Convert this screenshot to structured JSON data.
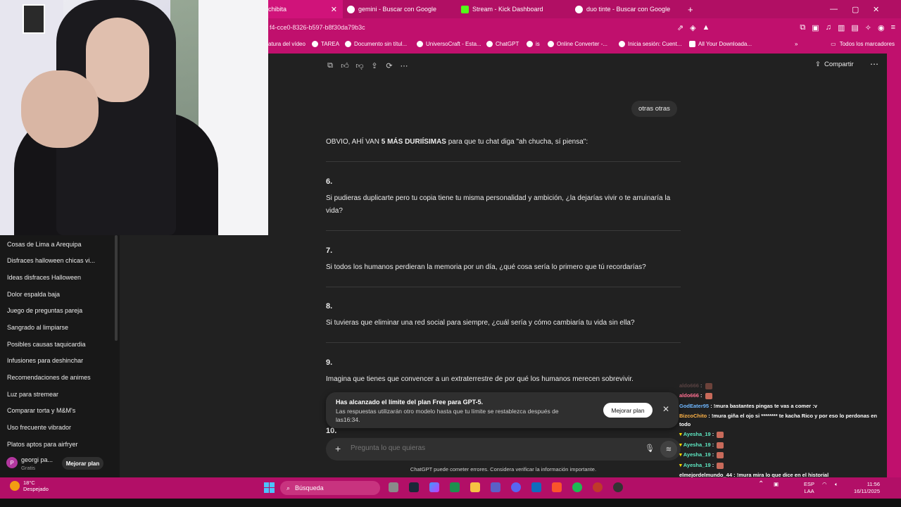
{
  "tabs": [
    {
      "label": "chibita",
      "active": true
    },
    {
      "label": "gemini - Buscar con Google"
    },
    {
      "label": "Stream - Kick Dashboard"
    },
    {
      "label": "duo tinte - Buscar con Google"
    }
  ],
  "address": {
    "url": "f4-cce0-8326-b597-b8f30da79b3c"
  },
  "bookmarks": [
    "atura del vídeo",
    "TAREA",
    "Documento sin títul...",
    "UniversoCraft - Esta...",
    "ChatGPT",
    "is",
    "Online Converter -...",
    "Inicia sesión: Cuent...",
    "All Your Downloada..."
  ],
  "bookmarks_right": "Todos los marcadores",
  "sidebar": {
    "items": [
      "Cosas de Lima a Arequipa",
      "Disfraces halloween chicas vi...",
      "Ideas disfraces Halloween",
      "Dolor espalda baja",
      "Juego de preguntas pareja",
      "Sangrado al limpiarse",
      "Posibles causas taquicardia",
      "Infusiones para deshinchar",
      "Recomendaciones de animes",
      "Luz para stremear",
      "Comparar torta y M&M's",
      "Uso frecuente vibrador",
      "Platos aptos para airfryer"
    ],
    "user": {
      "initial": "P",
      "name": "georgi pa...",
      "plan": "Gratis",
      "upgrade": "Mejorar plan"
    }
  },
  "header": {
    "share": "Compartir"
  },
  "chat": {
    "user_message": "otras otras",
    "intro_pre": "OBVIO, AHÍ VAN ",
    "intro_bold": "5 MÁS DURIÍSIMAS",
    "intro_post": " para que tu chat diga \"ah chucha, sí piensa\":",
    "questions": [
      {
        "num": "6.",
        "text": "Si pudieras duplicarte pero tu copia tiene tu misma personalidad y ambición, ¿la dejarías vivir o te arruinaría la vida?"
      },
      {
        "num": "7.",
        "text": "Si todos los humanos perdieran la memoria por un día, ¿qué cosa sería lo primero que tú recordarías?"
      },
      {
        "num": "8.",
        "text": "Si tuvieras que eliminar una red social para siempre, ¿cuál sería y cómo cambiaría tu vida sin ella?"
      },
      {
        "num": "9.",
        "text": "Imagina que tienes que convencer a un extraterrestre de por qué los humanos merecen sobrevivir."
      }
    ],
    "next_num": "10."
  },
  "limit_banner": {
    "title": "Has alcanzado el límite del plan Free para GPT-5.",
    "subtitle": "Las respuestas utilizarán otro modelo hasta que tu límite se restablezca después de las16:34.",
    "button": "Mejorar plan"
  },
  "composer": {
    "placeholder": "Pregunta lo que quieras",
    "disclaimer": "ChatGPT puede cometer errores. Considera verificar la información importante."
  },
  "kick_chat": [
    {
      "user": "aldo666",
      "color": "#9c6a6a",
      "msg": "",
      "faded": true
    },
    {
      "user": "aldo666",
      "color": "#ff6f91",
      "msg": ""
    },
    {
      "user": "GodEater95",
      "color": "#6fb7ff",
      "msg": "!mura bastantes pingas te vas a comer :v"
    },
    {
      "user": "BizcoChito",
      "color": "#ffb347",
      "msg": "!mura giña el ojo si ******** te kacha Rico y por eso lo perdonas en"
    },
    {
      "user": "",
      "color": "#ffffff",
      "msg": "todo"
    },
    {
      "user": "Ayesha_19",
      "color": "#5ee8c2",
      "msg": ""
    },
    {
      "user": "Ayesha_19",
      "color": "#5ee8c2",
      "msg": ""
    },
    {
      "user": "Ayesha_19",
      "color": "#5ee8c2",
      "msg": ""
    },
    {
      "user": "Ayesha_19",
      "color": "#5ee8c2",
      "msg": ""
    },
    {
      "user": "elmejordelmundo_44",
      "color": "#ffffff",
      "msg": "!mura mira lo que dice en el historial"
    },
    {
      "user": "Ayesha_19",
      "color": "#5ee8c2",
      "msg": ""
    }
  ],
  "taskbar": {
    "temp": "18°C",
    "weather": "Despejado",
    "search": "Búsqueda",
    "lang1": "ESP",
    "lang2": "LAA",
    "time": "11:56",
    "date": "16/11/2025"
  }
}
